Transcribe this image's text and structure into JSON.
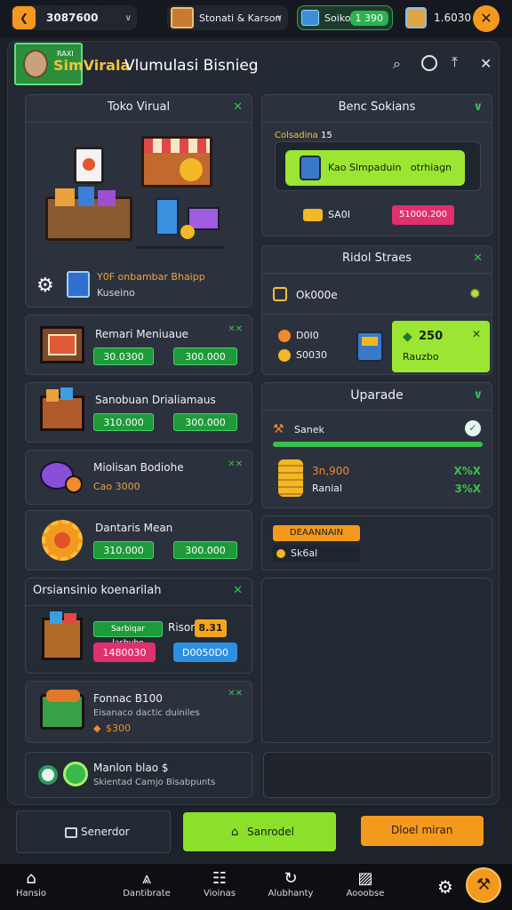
{
  "topbar": {
    "coins": "3087600",
    "store_label": "Stonati & Karson",
    "stock_label": "Soiko",
    "stock_value": "1 390",
    "gems_value": "1.6030"
  },
  "header": {
    "badge_top": "RAXI",
    "title_brand": "SimVirala",
    "title_rest": "Vlumulasi Bisnieg"
  },
  "toko": {
    "title": "Toko Virual",
    "note_orange": "Y0F onbambar Bhaipp",
    "note_sub": "Kuseino"
  },
  "items": [
    {
      "name": "Remari Meniuaue",
      "btn1": "30.0300",
      "btn2": "300.000"
    },
    {
      "name": "Sanobuan Drialiamaus",
      "btn1": "310.000",
      "btn2": "300.000"
    },
    {
      "name": "Miolisan Bodiohe",
      "sub": "Cao 3000"
    },
    {
      "name": "Dantaris Mean",
      "btn1": "310.000",
      "btn2": "300.000"
    }
  ],
  "orders": {
    "title": "Orsiansinio koenarilah",
    "tag_green": "Sarbiqar lasbubo",
    "tag_label": "Rison",
    "tag_orange": "8.31",
    "btn_pink": "1480030",
    "btn_blue": "D0050D0"
  },
  "card_left_2": {
    "name": "Fonnac B100",
    "sub": "Eisanaco dactic duiniles",
    "price": "$300"
  },
  "card_left_3": {
    "name": "Manlon blao $",
    "sub": "Skientad Camjo Bisabpunts"
  },
  "bensol": {
    "title": "Benc Sokians",
    "small_label": "Colsadina",
    "small_value": "15",
    "button": "Kao Slmpaduin   otrhiagn",
    "row_label": "SA0I",
    "row_value": "51000.200"
  },
  "risk": {
    "title": "Ridol Straes",
    "row1": "Ok000e",
    "l1": "D0I0",
    "l2": "S0030",
    "badge_value": "250",
    "badge_sub": "Rauzbo"
  },
  "upgrade": {
    "title": "Uparade",
    "label": "Sanek",
    "price_orange": "3n,900",
    "sub": "Ranial",
    "r1": "X%X",
    "r2": "3%X"
  },
  "dropdown": {
    "label": "DEAANNAIN",
    "value": "Sk6al"
  },
  "bottom": {
    "left": "Senerdor",
    "mid": "Sanrodel",
    "right": "Dloel miran"
  },
  "nav": [
    "Hansio",
    "Dantibrate",
    "Vioinas",
    "Alubhanty",
    "Aooobse"
  ]
}
